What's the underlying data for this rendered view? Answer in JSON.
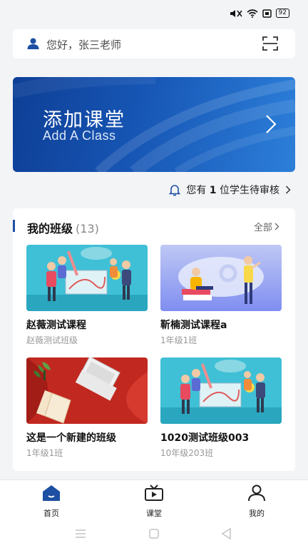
{
  "status_bar": {
    "battery": "92"
  },
  "greeting": {
    "text": "您好，张三老师"
  },
  "banner": {
    "title": "添加课堂",
    "subtitle": "Add A Class"
  },
  "notice": {
    "prefix": "您有",
    "count": "1",
    "suffix": "位学生待审核"
  },
  "classes": {
    "title": "我的班级",
    "count": "(13)",
    "all_label": "全部",
    "items": [
      {
        "name": "赵薇测试课程",
        "sub": "赵薇测试班级"
      },
      {
        "name": "靳楠测试课程a",
        "sub": "1年级1班"
      },
      {
        "name": "这是一个新建的班级",
        "sub": "1年级1班"
      },
      {
        "name": "1020测试班级003",
        "sub": "10年级203班"
      }
    ]
  },
  "tabs": [
    {
      "label": "首页",
      "icon": "home-icon",
      "active": true
    },
    {
      "label": "课堂",
      "icon": "tv-icon",
      "active": false
    },
    {
      "label": "我的",
      "icon": "person-icon",
      "active": false
    }
  ],
  "colors": {
    "primary": "#1d4fa3",
    "background": "#f3f4f6"
  }
}
